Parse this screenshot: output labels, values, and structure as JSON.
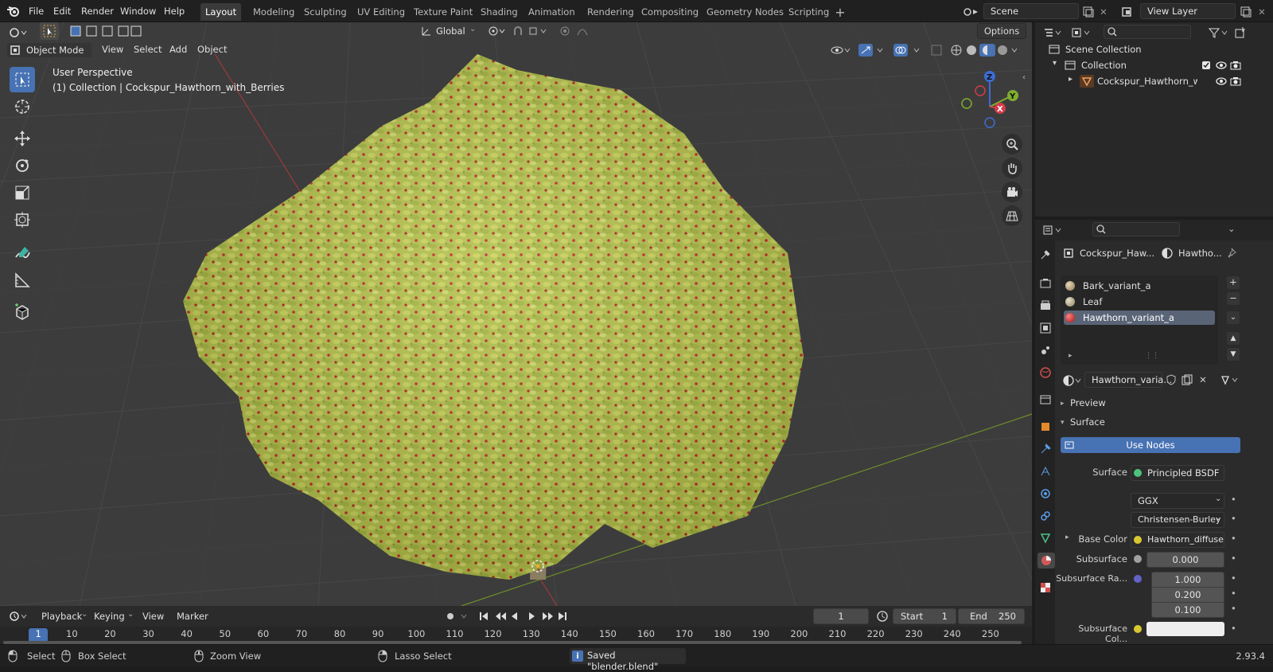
{
  "topbar": {
    "menus": [
      "File",
      "Edit",
      "Render",
      "Window",
      "Help"
    ],
    "workspaces": [
      "Layout",
      "Modeling",
      "Sculpting",
      "UV Editing",
      "Texture Paint",
      "Shading",
      "Animation",
      "Rendering",
      "Compositing",
      "Geometry Nodes",
      "Scripting"
    ],
    "active_workspace": "Layout",
    "scene_name": "Scene",
    "view_layer": "View Layer"
  },
  "viewport": {
    "mode": "Object Mode",
    "menus": [
      "View",
      "Select",
      "Add",
      "Object"
    ],
    "transform_orientation": "Global",
    "options_label": "Options",
    "overlay_title": "User Perspective",
    "overlay_subtitle": "(1) Collection | Cockspur_Hawthorn_with_Berries",
    "gizmo_axes": [
      "Z",
      "Y",
      "X"
    ],
    "colors": {
      "background": "#3c3c3c",
      "foliage": "#b8c54e",
      "berry": "#c8252b",
      "active": "#4772b3"
    }
  },
  "outliner": {
    "items": [
      {
        "label": "Scene Collection",
        "icon": "scene-collection-icon"
      },
      {
        "label": "Collection",
        "icon": "collection-icon"
      },
      {
        "label": "Cockspur_Hawthorn_with",
        "icon": "mesh-object-icon"
      }
    ]
  },
  "properties": {
    "object_name": "Cockspur_Haw...",
    "material_short": "Hawtho...",
    "material_slots": [
      "Bark_variant_a",
      "Leaf",
      "Hawthorn_variant_a"
    ],
    "active_slot": "Hawthorn_variant_a",
    "material_name": "Hawthorn_varia...",
    "panels": {
      "preview": "Preview",
      "surface": "Surface"
    },
    "use_nodes": "Use Nodes",
    "rows": {
      "surface_label": "Surface",
      "surface_value": "Principled BSDF",
      "distribution": "GGX",
      "subsurface_method": "Christensen-Burley",
      "base_color_label": "Base Color",
      "base_color_value": "Hawthorn_diffuse....",
      "subsurface_label": "Subsurface",
      "subsurface_value": "0.000",
      "subsurface_radius_label": "Subsurface Ra...",
      "subsurface_radius": [
        "1.000",
        "0.200",
        "0.100"
      ],
      "subsurface_color_label": "Subsurface Col..."
    }
  },
  "timeline": {
    "menus": [
      "Playback",
      "Keying",
      "View",
      "Marker"
    ],
    "current_frame": "1",
    "start_label": "Start",
    "start": "1",
    "end_label": "End",
    "end": "250",
    "ticks": [
      "1",
      "10",
      "20",
      "30",
      "40",
      "50",
      "60",
      "70",
      "80",
      "90",
      "100",
      "110",
      "120",
      "130",
      "140",
      "150",
      "160",
      "170",
      "180",
      "190",
      "200",
      "210",
      "220",
      "230",
      "240",
      "250"
    ]
  },
  "statusbar": {
    "select": "Select",
    "box_select": "Box Select",
    "zoom_view": "Zoom View",
    "lasso_select": "Lasso Select",
    "message": "Saved \"blender.blend\"",
    "version": "2.93.4"
  }
}
